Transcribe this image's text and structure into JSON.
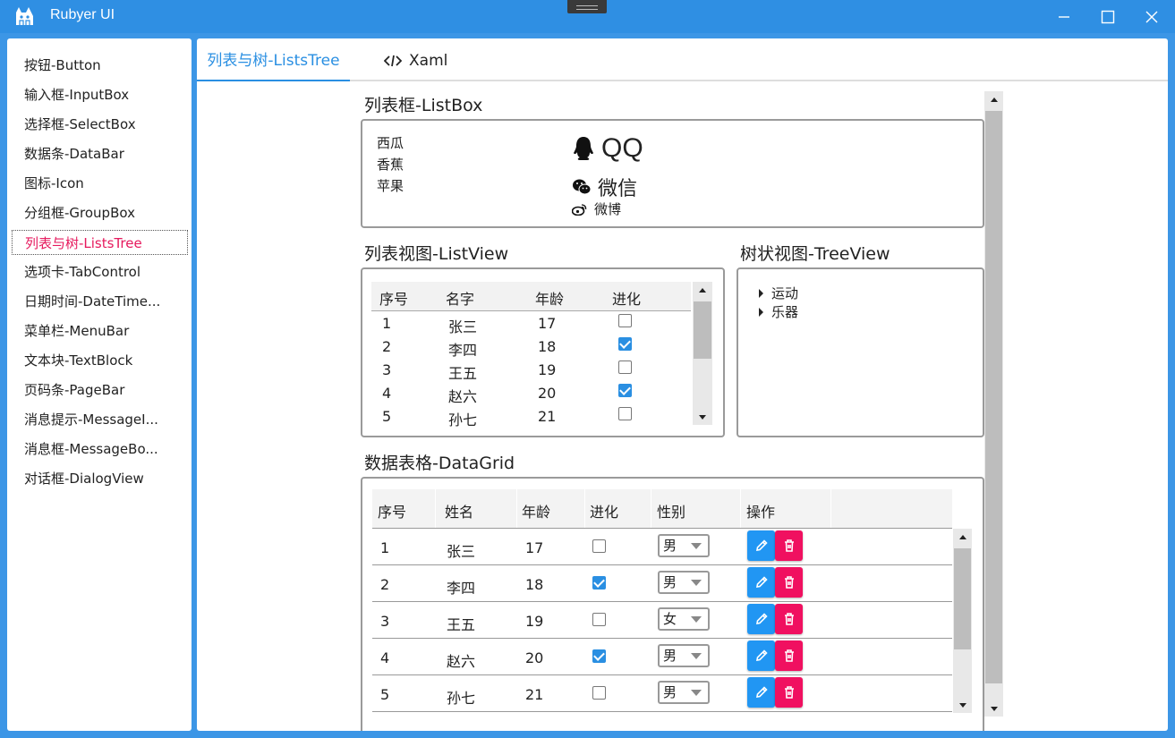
{
  "app": {
    "title": "Rubyer UI"
  },
  "sidebar": {
    "items": [
      {
        "label": "按钮-Button"
      },
      {
        "label": "输入框-InputBox"
      },
      {
        "label": "选择框-SelectBox"
      },
      {
        "label": "数据条-DataBar"
      },
      {
        "label": "图标-Icon"
      },
      {
        "label": "分组框-GroupBox"
      },
      {
        "label": "列表与树-ListsTree"
      },
      {
        "label": "选项卡-TabControl"
      },
      {
        "label": "日期时间-DateTime..."
      },
      {
        "label": "菜单栏-MenuBar"
      },
      {
        "label": "文本块-TextBlock"
      },
      {
        "label": "页码条-PageBar"
      },
      {
        "label": "消息提示-MessageI..."
      },
      {
        "label": "消息框-MessageBo..."
      },
      {
        "label": "对话框-DialogView"
      }
    ],
    "active_index": 6
  },
  "tabs": [
    {
      "label": "列表与树-ListsTree"
    },
    {
      "label": "Xaml"
    }
  ],
  "listbox": {
    "title": "列表框-ListBox",
    "items": [
      "西瓜",
      "香蕉",
      "苹果"
    ],
    "social": [
      {
        "icon": "qq-icon",
        "label": "QQ"
      },
      {
        "icon": "wechat-icon",
        "label": "微信"
      },
      {
        "icon": "weibo-icon",
        "label": "微博"
      }
    ]
  },
  "listview": {
    "title": "列表视图-ListView",
    "headers": [
      "序号",
      "名字",
      "年龄",
      "进化"
    ],
    "rows": [
      {
        "id": "1",
        "name": "张三",
        "age": "17",
        "evolved": false
      },
      {
        "id": "2",
        "name": "李四",
        "age": "18",
        "evolved": true
      },
      {
        "id": "3",
        "name": "王五",
        "age": "19",
        "evolved": false
      },
      {
        "id": "4",
        "name": "赵六",
        "age": "20",
        "evolved": true
      },
      {
        "id": "5",
        "name": "孙七",
        "age": "21",
        "evolved": false
      }
    ]
  },
  "treeview": {
    "title": "树状视图-TreeView",
    "nodes": [
      "运动",
      "乐器"
    ]
  },
  "datagrid": {
    "title": "数据表格-DataGrid",
    "headers": [
      "序号",
      "姓名",
      "年龄",
      "进化",
      "性别",
      "操作"
    ],
    "rows": [
      {
        "id": "1",
        "name": "张三",
        "age": "17",
        "evolved": false,
        "gender": "男"
      },
      {
        "id": "2",
        "name": "李四",
        "age": "18",
        "evolved": true,
        "gender": "男"
      },
      {
        "id": "3",
        "name": "王五",
        "age": "19",
        "evolved": false,
        "gender": "女"
      },
      {
        "id": "4",
        "name": "赵六",
        "age": "20",
        "evolved": true,
        "gender": "男"
      },
      {
        "id": "5",
        "name": "孙七",
        "age": "21",
        "evolved": false,
        "gender": "男"
      }
    ]
  },
  "colors": {
    "accent": "#2a8fe2",
    "active_nav": "#e6195d",
    "edit_button": "#2196f3",
    "delete_button": "#f01060"
  }
}
